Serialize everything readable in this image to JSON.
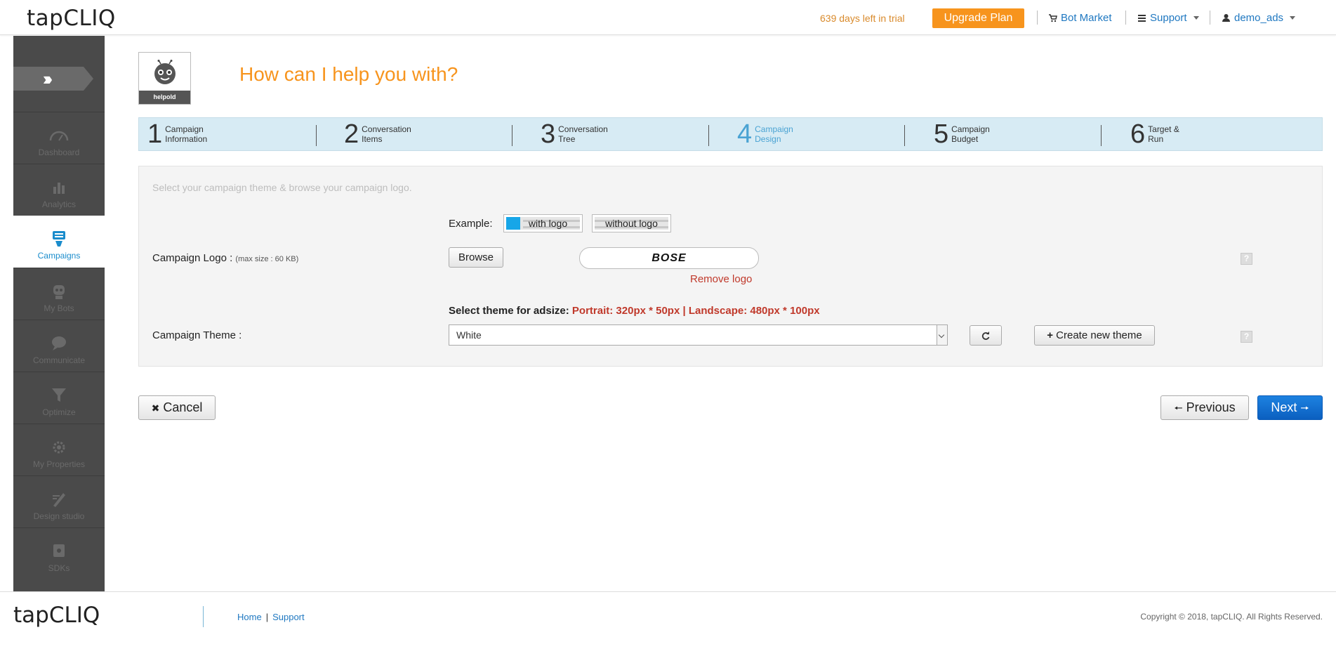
{
  "header": {
    "brand": "tapCLIQ",
    "trial_text": "639 days left in trial",
    "upgrade_label": "Upgrade Plan",
    "bot_market_label": "Bot Market",
    "support_label": "Support",
    "user_label": "demo_ads"
  },
  "sidebar": {
    "items": [
      {
        "label": "Dashboard",
        "icon": "gauge-icon"
      },
      {
        "label": "Analytics",
        "icon": "bar-chart-icon"
      },
      {
        "label": "Campaigns",
        "icon": "campaign-icon",
        "active": true
      },
      {
        "label": "My Bots",
        "icon": "bot-icon"
      },
      {
        "label": "Communicate",
        "icon": "chat-bubble-icon"
      },
      {
        "label": "Optimize",
        "icon": "funnel-icon"
      },
      {
        "label": "My Properties",
        "icon": "gear-icon"
      },
      {
        "label": "Design studio",
        "icon": "design-tools-icon"
      },
      {
        "label": "SDKs",
        "icon": "sdk-chip-icon"
      }
    ]
  },
  "bot": {
    "label": "helpold"
  },
  "page": {
    "title": "How can I help you with?"
  },
  "steps": [
    {
      "num": "1",
      "line1": "Campaign",
      "line2": "Information"
    },
    {
      "num": "2",
      "line1": "Conversation",
      "line2": "Items"
    },
    {
      "num": "3",
      "line1": "Conversation",
      "line2": "Tree"
    },
    {
      "num": "4",
      "line1": "Campaign",
      "line2": "Design",
      "active": true
    },
    {
      "num": "5",
      "line1": "Campaign",
      "line2": "Budget"
    },
    {
      "num": "6",
      "line1": "Target &",
      "line2": "Run"
    }
  ],
  "form": {
    "hint": "Select your campaign theme & browse your campaign logo.",
    "example_label": "Example:",
    "example_with_logo": "with logo",
    "example_without_logo": "without logo",
    "logo_label": "Campaign Logo :",
    "logo_max_size": "(max size : 60 KB)",
    "browse_label": "Browse",
    "logo_preview_text": "BOSE",
    "remove_logo_label": "Remove logo",
    "theme_hint_prefix": "Select theme for adsize:",
    "theme_hint_sizes": "Portrait: 320px * 50px | Landscape: 480px * 100px",
    "theme_label": "Campaign Theme :",
    "theme_selected": "White",
    "create_theme_label": "Create new theme",
    "help_glyph": "?"
  },
  "actions": {
    "cancel_label": "Cancel",
    "previous_label": "Previous",
    "next_label": "Next"
  },
  "footer": {
    "brand": "tapCLIQ",
    "home_label": "Home",
    "support_label": "Support",
    "pipe": "|",
    "copyright": "Copyright © 2018, tapCLIQ. All Rights Reserved."
  },
  "colors": {
    "accent_orange": "#f7941d",
    "link_blue": "#1f78c1",
    "active_step_blue": "#4aa3d3",
    "error_red": "#c0392b",
    "primary_button": "#0b5fc0",
    "sidebar_bg": "#4a4a4a"
  }
}
